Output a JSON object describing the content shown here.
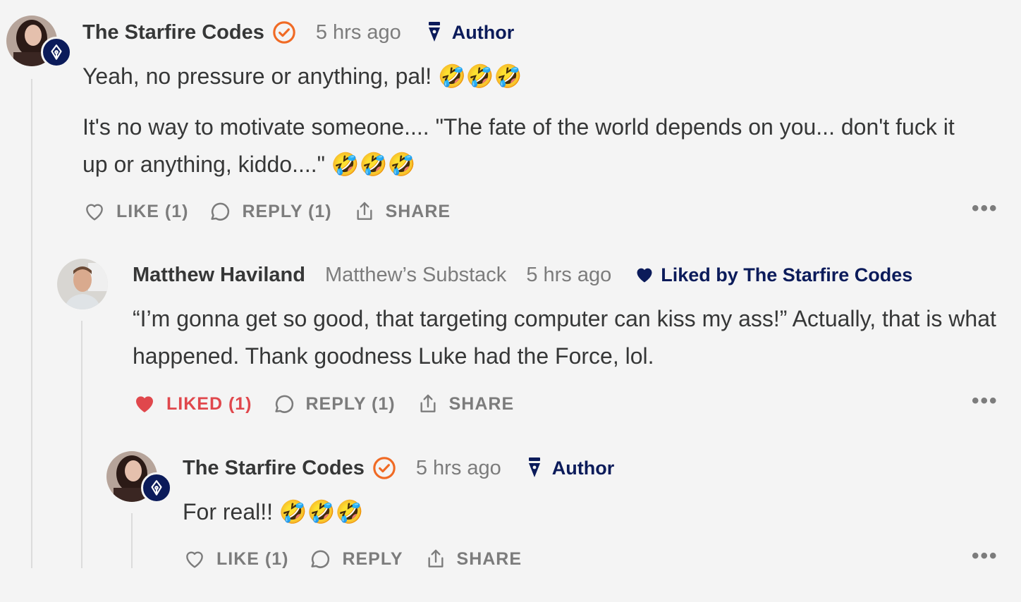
{
  "comments": [
    {
      "author": "The Starfire Codes",
      "time": "5 hrs ago",
      "role": "Author",
      "paragraphs": [
        "Yeah, no pressure or anything, pal! 🤣🤣🤣",
        "It's no way to motivate someone.... \"The fate of the world depends on you... don't fuck it up or anything, kiddo....\" 🤣🤣🤣"
      ],
      "like_label": "LIKE (1)",
      "reply_label": "REPLY (1)",
      "share_label": "SHARE",
      "more_label": "•••"
    },
    {
      "author": "Matthew Haviland",
      "publication": "Matthew’s Substack",
      "time": "5 hrs ago",
      "liked_by": "Liked by The Starfire Codes",
      "paragraphs": [
        "“I’m gonna get so good, that targeting computer can kiss my ass!” Actually, that is what happened. Thank goodness Luke had the Force, lol."
      ],
      "like_label": "LIKED (1)",
      "reply_label": "REPLY (1)",
      "share_label": "SHARE",
      "more_label": "•••"
    },
    {
      "author": "The Starfire Codes",
      "time": "5 hrs ago",
      "role": "Author",
      "paragraphs": [
        "For real!! 🤣🤣🤣"
      ],
      "like_label": "LIKE (1)",
      "reply_label": "REPLY",
      "share_label": "SHARE",
      "more_label": "•••"
    }
  ],
  "colors": {
    "background": "#f4f4f4",
    "text": "#363737",
    "muted": "#7c7c7c",
    "navy": "#0b1b5a",
    "liked_red": "#e0474c",
    "verified_orange": "#f06a24"
  },
  "icons": {
    "verified": "verified-check-icon",
    "author": "pen-nib-icon",
    "like": "heart-outline-icon",
    "liked": "heart-filled-icon",
    "reply": "speech-bubble-icon",
    "share": "share-icon",
    "more": "more-dots-icon"
  }
}
